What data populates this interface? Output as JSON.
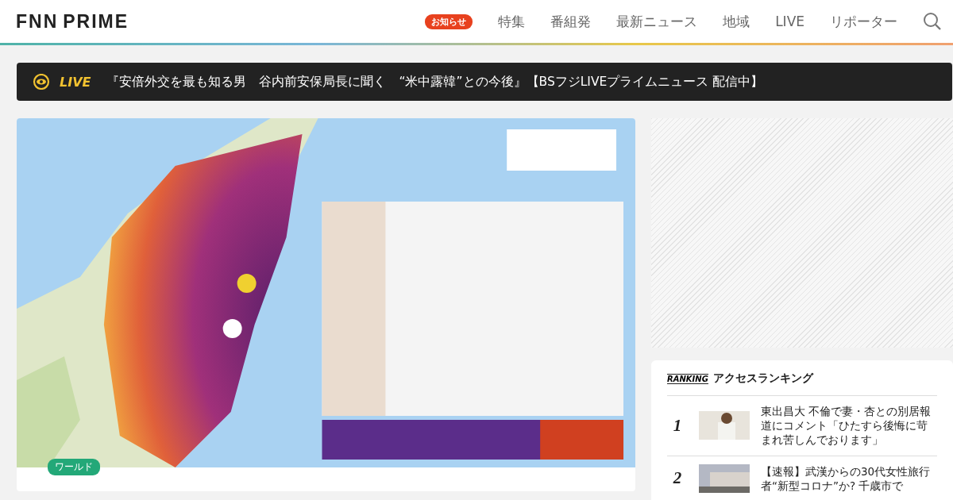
{
  "header": {
    "logo_left": "FNN",
    "logo_right": "PRIME",
    "notice_badge": "お知らせ",
    "nav": [
      "特集",
      "番組発",
      "最新ニュース",
      "地域",
      "LIVE",
      "リポーター"
    ]
  },
  "live_bar": {
    "label": "LIVE",
    "text": "『安倍外交を最も知る男　谷内前安保局長に聞く　“米中露韓”との今後』【BSフジLIVEプライムニュース 配信中】"
  },
  "article": {
    "category": "ワールド"
  },
  "ranking": {
    "badge": "RANKING",
    "title": "アクセスランキング",
    "items": [
      {
        "rank": "1",
        "title": "東出昌大 不倫で妻・杏との別居報道にコメント「ひたすら後悔に苛まれ苦しんでおります」"
      },
      {
        "rank": "2",
        "title": "【速報】武漢からの30代女性旅行者“新型コロナ”か? 千歳市で"
      }
    ]
  }
}
